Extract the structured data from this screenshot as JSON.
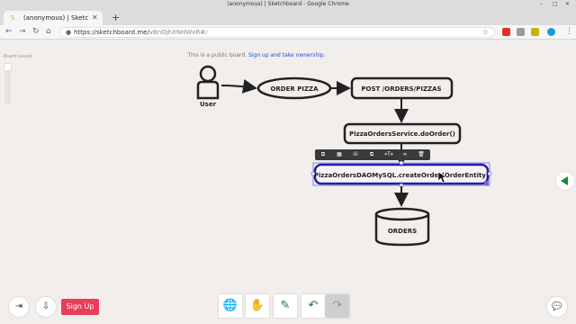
{
  "window": {
    "title": "(anonymous) | Sketchboard - Google Chrome"
  },
  "tab": {
    "label": "(anonymous) | Sketchboa",
    "close": "✕",
    "new": "+"
  },
  "nav": {
    "back": "←",
    "forward": "→",
    "reload": "↻",
    "home": "⌂",
    "url_prefix": "https://sketchboard.me/",
    "url_rest": "vBnOjhXNHWxR#/",
    "lock": "🔒",
    "star": "☆"
  },
  "extensions": [
    {
      "name": "adblock-icon",
      "color": "#d6332a"
    },
    {
      "name": "shield-icon",
      "color": "#888888"
    },
    {
      "name": "pin-icon",
      "color": "#c9b200"
    },
    {
      "name": "skype-icon",
      "color": "#1e9ad6"
    }
  ],
  "menu_glyph": "⋮",
  "board": {
    "saved_label": "Board saved",
    "notice": "This is a public board.",
    "notice_link": "Sign up and take ownership."
  },
  "diagram": {
    "actor": "User",
    "ellipse": "ORDER PIZZA",
    "post_box": "POST /ORDERS/PIZZAS",
    "service_box": "PizzaOrdersService.doOrder()",
    "dao_box": "PizzaOrdersDAOMySQL.createOrder(OrderEntity)",
    "db": "ORDERS"
  },
  "context_menu": [
    "⧉",
    "▦",
    "☏",
    "⧉",
    "«T»",
    "∞",
    "🗑"
  ],
  "left_buttons": {
    "import": "⇥",
    "export": "⇩",
    "signup": "Sign Up"
  },
  "tools": [
    {
      "name": "globe-tool",
      "glyph": "🌐"
    },
    {
      "name": "hand-tool",
      "glyph": "✋"
    },
    {
      "name": "pen-tool",
      "glyph": "✎"
    },
    {
      "name": "undo-tool",
      "glyph": "↶"
    },
    {
      "name": "redo-tool",
      "glyph": "↷"
    }
  ],
  "chat_glyph": "💬"
}
